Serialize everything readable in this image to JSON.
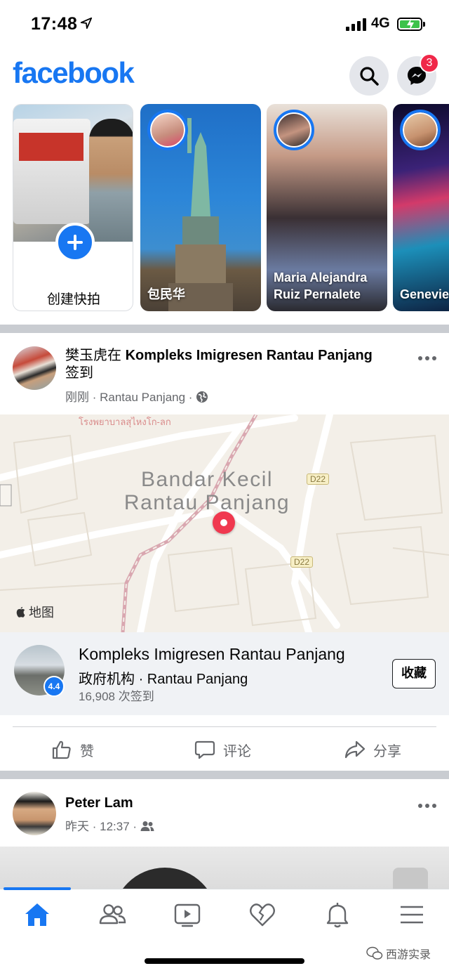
{
  "status_bar": {
    "time": "17:48",
    "network": "4G"
  },
  "header": {
    "logo": "facebook",
    "messenger_badge": "3"
  },
  "stories": {
    "create_label": "创建快拍",
    "items": [
      {
        "name": "包民华"
      },
      {
        "name": "Maria Alejandra Ruiz Pernalete"
      },
      {
        "name": "Genevie Capcap"
      }
    ]
  },
  "post1": {
    "author": "樊玉虎在",
    "place_link": "Kompleks Imigresen Rantau Panjang",
    "action": "签到",
    "time": "刚刚",
    "location": "Rantau Panjang",
    "map": {
      "city": "Bandar Kecil Rantau Panjang",
      "thai_label": "โรงพยาบาลสุไหงโก-ลก",
      "road_labels": [
        "D22",
        "D22"
      ],
      "attribution": "地图"
    },
    "place_card": {
      "name": "Kompleks Imigresen Rantau Panjang",
      "category": "政府机构",
      "location": "Rantau Panjang",
      "checkins": "16,908 次签到",
      "rating": "4.4",
      "save_label": "收藏"
    },
    "actions": {
      "like": "赞",
      "comment": "评论",
      "share": "分享"
    }
  },
  "post2": {
    "author": "Peter Lam",
    "date": "昨天",
    "time": "12:37"
  },
  "watermark": "西游实录",
  "colors": {
    "brand": "#1877f2",
    "badge": "#f02849",
    "map_pin": "#f0384f"
  }
}
